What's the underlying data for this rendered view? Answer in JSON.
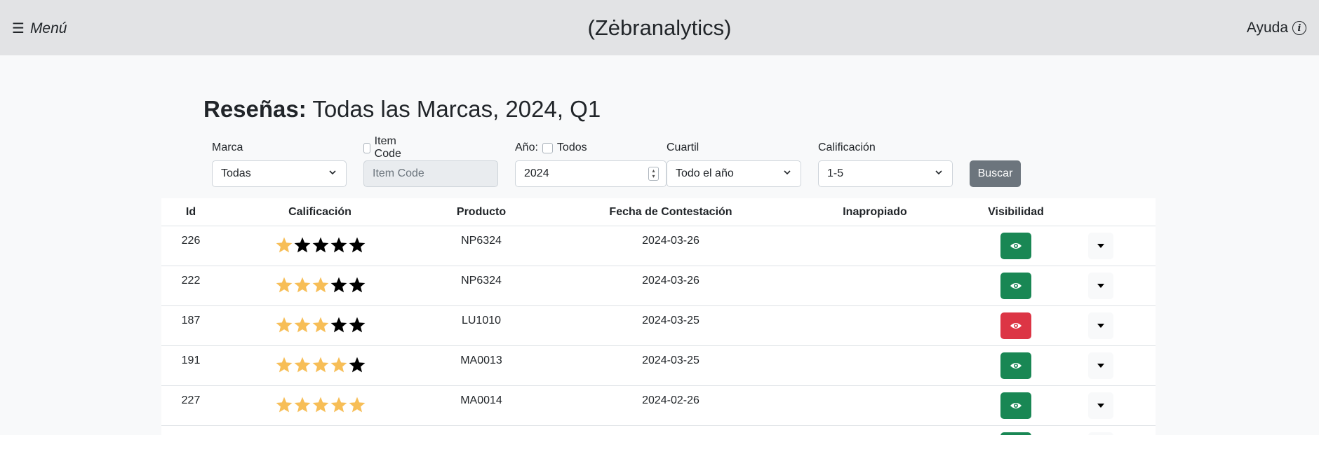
{
  "header": {
    "menu_label": "Menú",
    "brand": "(Zėbranalytics)",
    "help_label": "Ayuda"
  },
  "page": {
    "title_bold": "Reseñas:",
    "title_rest": " Todas las Marcas, 2024, Q1"
  },
  "filters": {
    "brand": {
      "label": "Marca",
      "value": "Todas"
    },
    "item_code": {
      "label": "Item Code",
      "placeholder": "Item Code",
      "checked": false
    },
    "year": {
      "label": "Año:",
      "all_label": "Todos",
      "value": "2024",
      "all_checked": false
    },
    "quarter": {
      "label": "Cuartil",
      "value": "Todo el año"
    },
    "rating": {
      "label": "Calificación",
      "value": "1-5"
    },
    "search_button": "Buscar"
  },
  "table": {
    "headers": {
      "id": "Id",
      "rating": "Calificación",
      "product": "Producto",
      "answered_date": "Fecha de Contestación",
      "inappropriate": "Inapropiado",
      "visibility": "Visibilidad"
    },
    "rows": [
      {
        "id": "226",
        "rating": 1,
        "product": "NP6324",
        "date": "2024-03-26",
        "inappropriate": "",
        "visible": true
      },
      {
        "id": "222",
        "rating": 3,
        "product": "NP6324",
        "date": "2024-03-26",
        "inappropriate": "",
        "visible": true
      },
      {
        "id": "187",
        "rating": 3,
        "product": "LU1010",
        "date": "2024-03-25",
        "inappropriate": "",
        "visible": false
      },
      {
        "id": "191",
        "rating": 4,
        "product": "MA0013",
        "date": "2024-03-25",
        "inappropriate": "",
        "visible": true
      },
      {
        "id": "227",
        "rating": 5,
        "product": "MA0014",
        "date": "2024-02-26",
        "inappropriate": "",
        "visible": true
      },
      {
        "id": "",
        "rating": 0,
        "product": "",
        "date": "",
        "inappropriate": "",
        "visible": true
      }
    ]
  },
  "colors": {
    "star_filled": "#f7be57",
    "star_empty": "#000000",
    "visible_button": "#198754",
    "hidden_button": "#dc3545",
    "search_button": "#6c757d",
    "topbar": "#e2e3e5"
  },
  "icons": {
    "menu": "hamburger-icon",
    "help": "info-circle-icon",
    "visibility": "eye-icon",
    "row_menu": "caret-down-icon",
    "select": "chevron-down-icon"
  }
}
